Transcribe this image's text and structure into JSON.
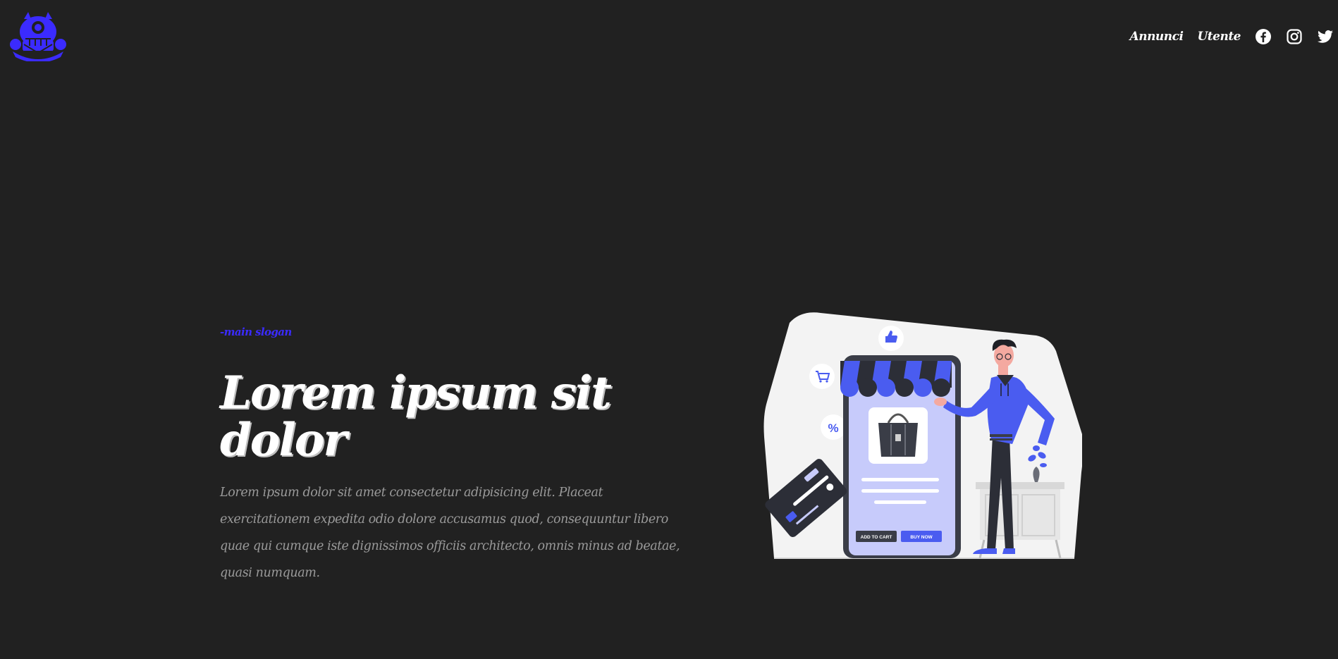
{
  "header": {
    "logo_icon": "monster-logo-icon",
    "nav": {
      "link_1": "Annunci",
      "link_2": "Utente",
      "icons": [
        "facebook-icon",
        "instagram-icon",
        "twitter-icon"
      ]
    }
  },
  "hero": {
    "slogan": "-main slogan",
    "title": "Lorem ipsum sit dolor",
    "description": "Lorem ipsum dolor sit amet consectetur adipisicing elit. Placeat exercitationem expedita odio dolore accusamus quod, consequuntur libero quae qui cumque iste dignissimos officiis architecto, omnis minus ad beatae, quasi numquam."
  },
  "illustration": {
    "add_to_cart_label": "ADD TO CART",
    "buy_now_label": "BUY NOW"
  },
  "colors": {
    "background": "#212121",
    "accent": "#3b2bff",
    "illustration_accent": "#4a5cf0"
  }
}
